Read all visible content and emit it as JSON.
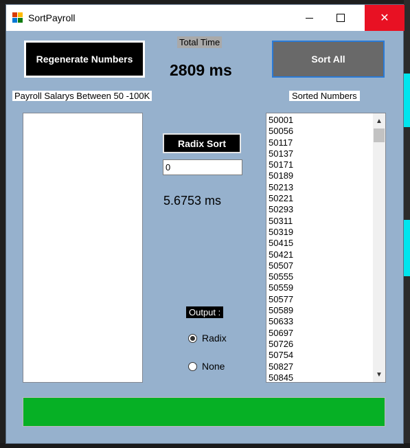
{
  "window": {
    "title": "SortPayroll"
  },
  "buttons": {
    "regenerate_label": "Regenerate Numbers",
    "sort_all_label": "Sort All",
    "radix_sort_label": "Radix Sort"
  },
  "labels": {
    "total_time": "Total Time",
    "total_time_value": "2809 ms",
    "payroll_range": "Payroll Salarys Between 50 -100K",
    "sorted_numbers": "Sorted Numbers",
    "radix_time": "5.6753 ms",
    "output": "Output :"
  },
  "inputs": {
    "radix_value": "0"
  },
  "radio": {
    "radix_label": "Radix",
    "none_label": "None",
    "selected": "Radix"
  },
  "sorted_list": [
    "50001",
    "50056",
    "50117",
    "50137",
    "50171",
    "50189",
    "50213",
    "50221",
    "50293",
    "50311",
    "50319",
    "50415",
    "50421",
    "50507",
    "50555",
    "50559",
    "50577",
    "50589",
    "50633",
    "50697",
    "50726",
    "50754",
    "50827",
    "50845"
  ],
  "progress": {
    "fraction": 1.0,
    "color": "#06b025"
  },
  "colors": {
    "form_bg": "#96b1cd",
    "close_hover": "#e81123"
  },
  "icons": [
    "app-icon",
    "minimize-icon",
    "maximize-icon",
    "close-icon",
    "scroll-up-icon",
    "scroll-down-icon"
  ]
}
